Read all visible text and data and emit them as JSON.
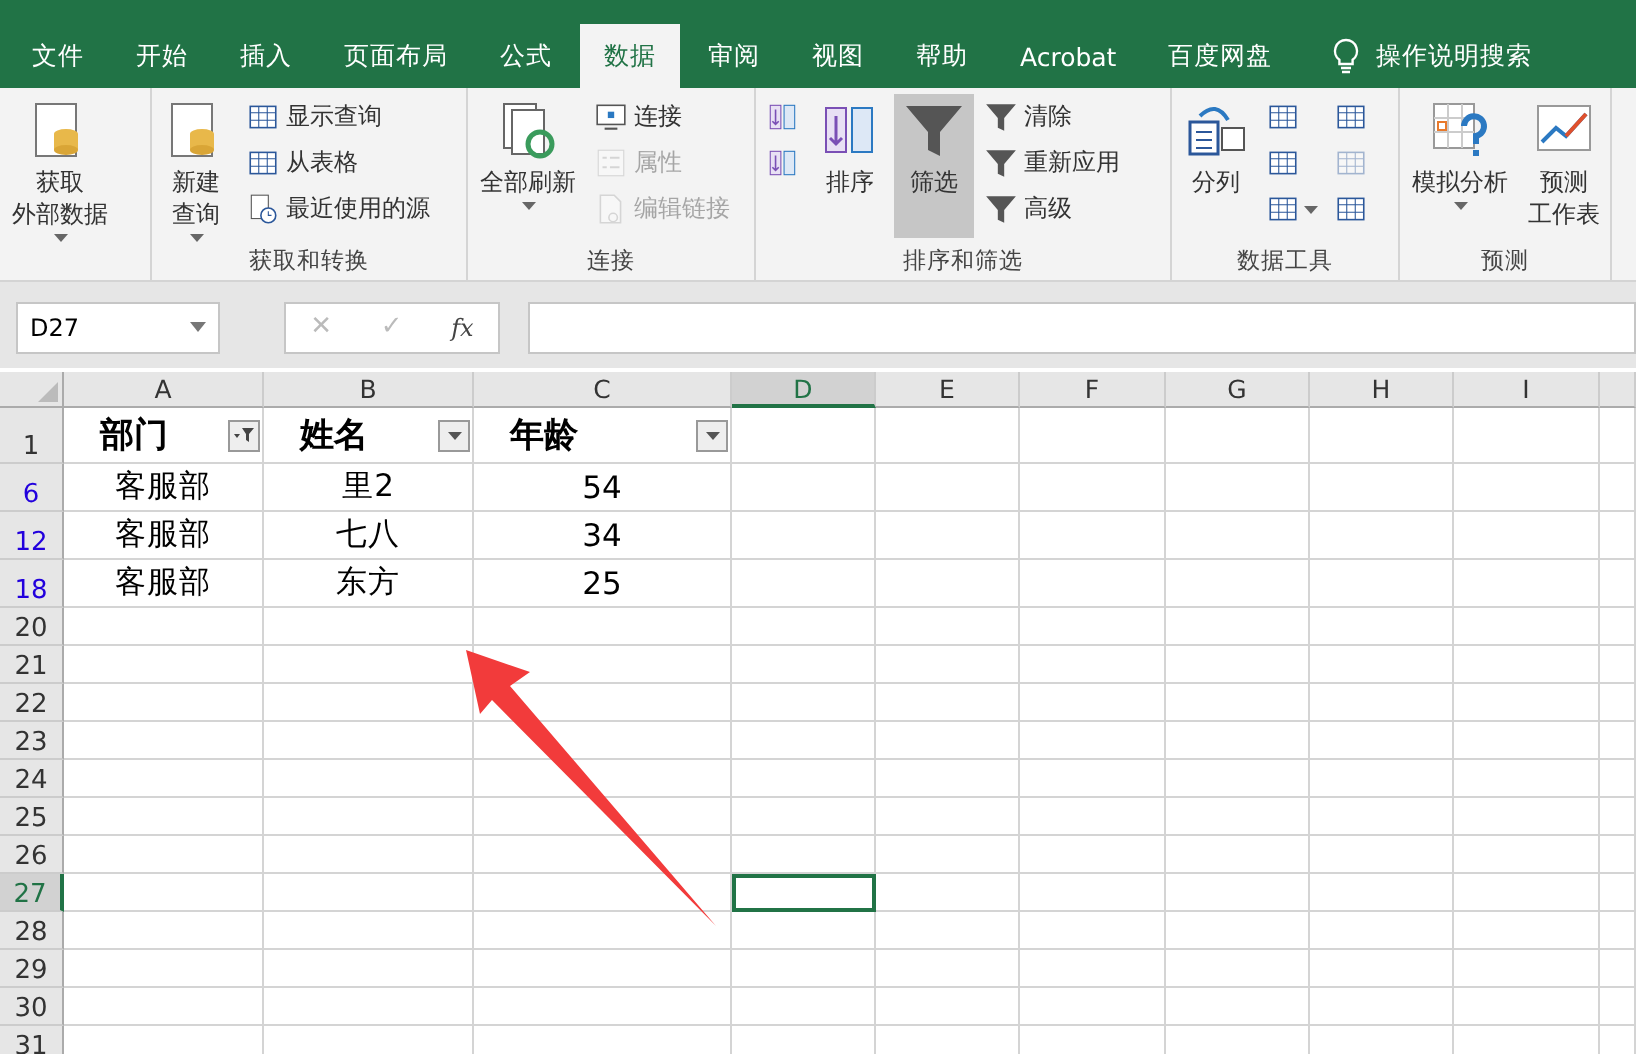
{
  "tabs": [
    {
      "label": "文件",
      "selected": false
    },
    {
      "label": "开始",
      "selected": false
    },
    {
      "label": "插入",
      "selected": false
    },
    {
      "label": "页面布局",
      "selected": false
    },
    {
      "label": "公式",
      "selected": false
    },
    {
      "label": "数据",
      "selected": true
    },
    {
      "label": "审阅",
      "selected": false
    },
    {
      "label": "视图",
      "selected": false
    },
    {
      "label": "帮助",
      "selected": false
    },
    {
      "label": "Acrobat",
      "selected": false
    },
    {
      "label": "百度网盘",
      "selected": false
    }
  ],
  "tell_me": "操作说明搜索",
  "ribbon_groups": [
    {
      "columns": [
        [
          {
            "kind": "large",
            "lines": [
              "获取",
              "外部数据"
            ],
            "dropdown": true,
            "disabled": false,
            "pressed": false
          }
        ]
      ]
    },
    {
      "label": "获取和转换",
      "columns": [
        [
          {
            "kind": "large",
            "lines": [
              "新建",
              "查询"
            ],
            "dropdown": true,
            "disabled": false,
            "pressed": false
          }
        ],
        [
          {
            "kind": "small",
            "lines": [
              "显示查询"
            ],
            "dropdown": false,
            "disabled": false,
            "pressed": false
          },
          {
            "kind": "small",
            "lines": [
              "从表格"
            ],
            "dropdown": false,
            "disabled": false,
            "pressed": false
          },
          {
            "kind": "small",
            "lines": [
              "最近使用的源"
            ],
            "dropdown": false,
            "disabled": false,
            "pressed": false
          }
        ]
      ]
    },
    {
      "label": "连接",
      "columns": [
        [
          {
            "kind": "large",
            "lines": [
              "全部刷新"
            ],
            "dropdown": true,
            "disabled": false,
            "pressed": false
          }
        ],
        [
          {
            "kind": "small",
            "lines": [
              "连接"
            ],
            "dropdown": false,
            "disabled": false,
            "pressed": false
          },
          {
            "kind": "small",
            "lines": [
              "属性"
            ],
            "dropdown": false,
            "disabled": true,
            "pressed": false
          },
          {
            "kind": "small",
            "lines": [
              "编辑链接"
            ],
            "dropdown": false,
            "disabled": true,
            "pressed": false
          }
        ]
      ]
    },
    {
      "label": "排序和筛选",
      "columns": [
        [
          {
            "kind": "icon",
            "dropdown": false,
            "disabled": false,
            "pressed": false
          },
          {
            "kind": "icon",
            "dropdown": false,
            "disabled": false,
            "pressed": false
          }
        ],
        [
          {
            "kind": "large",
            "lines": [
              "排序"
            ],
            "dropdown": false,
            "disabled": false,
            "pressed": false
          }
        ],
        [
          {
            "kind": "large",
            "lines": [
              "筛选"
            ],
            "dropdown": false,
            "disabled": false,
            "pressed": true
          }
        ],
        [
          {
            "kind": "small",
            "lines": [
              "清除"
            ],
            "dropdown": false,
            "disabled": false,
            "pressed": false
          },
          {
            "kind": "small",
            "lines": [
              "重新应用"
            ],
            "dropdown": false,
            "disabled": false,
            "pressed": false
          },
          {
            "kind": "small",
            "lines": [
              "高级"
            ],
            "dropdown": false,
            "disabled": false,
            "pressed": false
          }
        ]
      ]
    },
    {
      "label": "数据工具",
      "columns": [
        [
          {
            "kind": "large",
            "lines": [
              "分列"
            ],
            "dropdown": false,
            "disabled": false,
            "pressed": false
          }
        ],
        [
          {
            "kind": "icon",
            "dropdown": false,
            "disabled": false,
            "pressed": false
          },
          {
            "kind": "icon",
            "dropdown": false,
            "disabled": false,
            "pressed": false
          },
          {
            "kind": "icon",
            "dropdown": true,
            "disabled": false,
            "pressed": false
          }
        ],
        [
          {
            "kind": "icon",
            "dropdown": false,
            "disabled": false,
            "pressed": false
          },
          {
            "kind": "icon",
            "dropdown": false,
            "disabled": true,
            "pressed": false
          },
          {
            "kind": "icon",
            "dropdown": false,
            "disabled": false,
            "pressed": false
          }
        ]
      ]
    },
    {
      "label": "预测",
      "columns": [
        [
          {
            "kind": "large",
            "lines": [
              "模拟分析"
            ],
            "dropdown": true,
            "disabled": false,
            "pressed": false
          }
        ],
        [
          {
            "kind": "large",
            "lines": [
              "预测",
              "工作表"
            ],
            "dropdown": false,
            "disabled": false,
            "pressed": false
          }
        ]
      ]
    }
  ],
  "formula_bar": {
    "name_box": "D27",
    "cancel": "✕",
    "enter": "✓",
    "fx": "fx"
  },
  "sheet": {
    "columns": [
      {
        "label": "A",
        "selected": false
      },
      {
        "label": "B",
        "selected": false
      },
      {
        "label": "C",
        "selected": false
      },
      {
        "label": "D",
        "selected": true
      },
      {
        "label": "E",
        "selected": false
      },
      {
        "label": "F",
        "selected": false
      },
      {
        "label": "G",
        "selected": false
      },
      {
        "label": "H",
        "selected": false
      },
      {
        "label": "I",
        "selected": false
      }
    ],
    "rows": [
      {
        "number": "1",
        "kind": "header",
        "filtered": false,
        "selected": false,
        "cells": [
          {
            "text": "部门",
            "filter_applied": true
          },
          {
            "text": "姓名",
            "filter_applied": false
          },
          {
            "text": "年龄",
            "filter_applied": false
          }
        ]
      },
      {
        "number": "6",
        "kind": "data",
        "filtered": true,
        "selected": false,
        "cells": [
          {
            "text": "客服部"
          },
          {
            "text": "里2"
          },
          {
            "text": "54"
          }
        ]
      },
      {
        "number": "12",
        "kind": "data",
        "filtered": true,
        "selected": false,
        "cells": [
          {
            "text": "客服部"
          },
          {
            "text": "七八"
          },
          {
            "text": "34"
          }
        ]
      },
      {
        "number": "18",
        "kind": "data",
        "filtered": true,
        "selected": false,
        "cells": [
          {
            "text": "客服部"
          },
          {
            "text": "东方"
          },
          {
            "text": "25"
          }
        ]
      },
      {
        "number": "20",
        "kind": "empty",
        "filtered": false,
        "selected": false,
        "cells": []
      },
      {
        "number": "21",
        "kind": "empty",
        "filtered": false,
        "selected": false,
        "cells": []
      },
      {
        "number": "22",
        "kind": "empty",
        "filtered": false,
        "selected": false,
        "cells": []
      },
      {
        "number": "23",
        "kind": "empty",
        "filtered": false,
        "selected": false,
        "cells": []
      },
      {
        "number": "24",
        "kind": "empty",
        "filtered": false,
        "selected": false,
        "cells": []
      },
      {
        "number": "25",
        "kind": "empty",
        "filtered": false,
        "selected": false,
        "cells": []
      },
      {
        "number": "26",
        "kind": "empty",
        "filtered": false,
        "selected": false,
        "cells": []
      },
      {
        "number": "27",
        "kind": "empty",
        "filtered": false,
        "selected": true,
        "cells": []
      },
      {
        "number": "28",
        "kind": "empty",
        "filtered": false,
        "selected": false,
        "cells": []
      },
      {
        "number": "29",
        "kind": "empty",
        "filtered": false,
        "selected": false,
        "cells": []
      },
      {
        "number": "30",
        "kind": "empty",
        "filtered": false,
        "selected": false,
        "cells": []
      },
      {
        "number": "31",
        "kind": "empty",
        "filtered": false,
        "selected": false,
        "cells": []
      }
    ]
  }
}
